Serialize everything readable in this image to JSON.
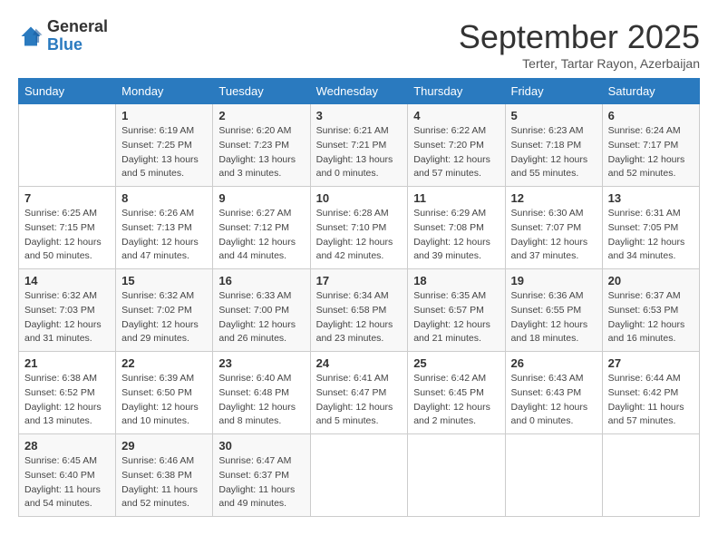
{
  "header": {
    "logo_general": "General",
    "logo_blue": "Blue",
    "month_title": "September 2025",
    "location": "Terter, Tartar Rayon, Azerbaijan"
  },
  "days_of_week": [
    "Sunday",
    "Monday",
    "Tuesday",
    "Wednesday",
    "Thursday",
    "Friday",
    "Saturday"
  ],
  "weeks": [
    [
      {
        "day": "",
        "content": ""
      },
      {
        "day": "1",
        "content": "Sunrise: 6:19 AM\nSunset: 7:25 PM\nDaylight: 13 hours\nand 5 minutes."
      },
      {
        "day": "2",
        "content": "Sunrise: 6:20 AM\nSunset: 7:23 PM\nDaylight: 13 hours\nand 3 minutes."
      },
      {
        "day": "3",
        "content": "Sunrise: 6:21 AM\nSunset: 7:21 PM\nDaylight: 13 hours\nand 0 minutes."
      },
      {
        "day": "4",
        "content": "Sunrise: 6:22 AM\nSunset: 7:20 PM\nDaylight: 12 hours\nand 57 minutes."
      },
      {
        "day": "5",
        "content": "Sunrise: 6:23 AM\nSunset: 7:18 PM\nDaylight: 12 hours\nand 55 minutes."
      },
      {
        "day": "6",
        "content": "Sunrise: 6:24 AM\nSunset: 7:17 PM\nDaylight: 12 hours\nand 52 minutes."
      }
    ],
    [
      {
        "day": "7",
        "content": "Sunrise: 6:25 AM\nSunset: 7:15 PM\nDaylight: 12 hours\nand 50 minutes."
      },
      {
        "day": "8",
        "content": "Sunrise: 6:26 AM\nSunset: 7:13 PM\nDaylight: 12 hours\nand 47 minutes."
      },
      {
        "day": "9",
        "content": "Sunrise: 6:27 AM\nSunset: 7:12 PM\nDaylight: 12 hours\nand 44 minutes."
      },
      {
        "day": "10",
        "content": "Sunrise: 6:28 AM\nSunset: 7:10 PM\nDaylight: 12 hours\nand 42 minutes."
      },
      {
        "day": "11",
        "content": "Sunrise: 6:29 AM\nSunset: 7:08 PM\nDaylight: 12 hours\nand 39 minutes."
      },
      {
        "day": "12",
        "content": "Sunrise: 6:30 AM\nSunset: 7:07 PM\nDaylight: 12 hours\nand 37 minutes."
      },
      {
        "day": "13",
        "content": "Sunrise: 6:31 AM\nSunset: 7:05 PM\nDaylight: 12 hours\nand 34 minutes."
      }
    ],
    [
      {
        "day": "14",
        "content": "Sunrise: 6:32 AM\nSunset: 7:03 PM\nDaylight: 12 hours\nand 31 minutes."
      },
      {
        "day": "15",
        "content": "Sunrise: 6:32 AM\nSunset: 7:02 PM\nDaylight: 12 hours\nand 29 minutes."
      },
      {
        "day": "16",
        "content": "Sunrise: 6:33 AM\nSunset: 7:00 PM\nDaylight: 12 hours\nand 26 minutes."
      },
      {
        "day": "17",
        "content": "Sunrise: 6:34 AM\nSunset: 6:58 PM\nDaylight: 12 hours\nand 23 minutes."
      },
      {
        "day": "18",
        "content": "Sunrise: 6:35 AM\nSunset: 6:57 PM\nDaylight: 12 hours\nand 21 minutes."
      },
      {
        "day": "19",
        "content": "Sunrise: 6:36 AM\nSunset: 6:55 PM\nDaylight: 12 hours\nand 18 minutes."
      },
      {
        "day": "20",
        "content": "Sunrise: 6:37 AM\nSunset: 6:53 PM\nDaylight: 12 hours\nand 16 minutes."
      }
    ],
    [
      {
        "day": "21",
        "content": "Sunrise: 6:38 AM\nSunset: 6:52 PM\nDaylight: 12 hours\nand 13 minutes."
      },
      {
        "day": "22",
        "content": "Sunrise: 6:39 AM\nSunset: 6:50 PM\nDaylight: 12 hours\nand 10 minutes."
      },
      {
        "day": "23",
        "content": "Sunrise: 6:40 AM\nSunset: 6:48 PM\nDaylight: 12 hours\nand 8 minutes."
      },
      {
        "day": "24",
        "content": "Sunrise: 6:41 AM\nSunset: 6:47 PM\nDaylight: 12 hours\nand 5 minutes."
      },
      {
        "day": "25",
        "content": "Sunrise: 6:42 AM\nSunset: 6:45 PM\nDaylight: 12 hours\nand 2 minutes."
      },
      {
        "day": "26",
        "content": "Sunrise: 6:43 AM\nSunset: 6:43 PM\nDaylight: 12 hours\nand 0 minutes."
      },
      {
        "day": "27",
        "content": "Sunrise: 6:44 AM\nSunset: 6:42 PM\nDaylight: 11 hours\nand 57 minutes."
      }
    ],
    [
      {
        "day": "28",
        "content": "Sunrise: 6:45 AM\nSunset: 6:40 PM\nDaylight: 11 hours\nand 54 minutes."
      },
      {
        "day": "29",
        "content": "Sunrise: 6:46 AM\nSunset: 6:38 PM\nDaylight: 11 hours\nand 52 minutes."
      },
      {
        "day": "30",
        "content": "Sunrise: 6:47 AM\nSunset: 6:37 PM\nDaylight: 11 hours\nand 49 minutes."
      },
      {
        "day": "",
        "content": ""
      },
      {
        "day": "",
        "content": ""
      },
      {
        "day": "",
        "content": ""
      },
      {
        "day": "",
        "content": ""
      }
    ]
  ]
}
